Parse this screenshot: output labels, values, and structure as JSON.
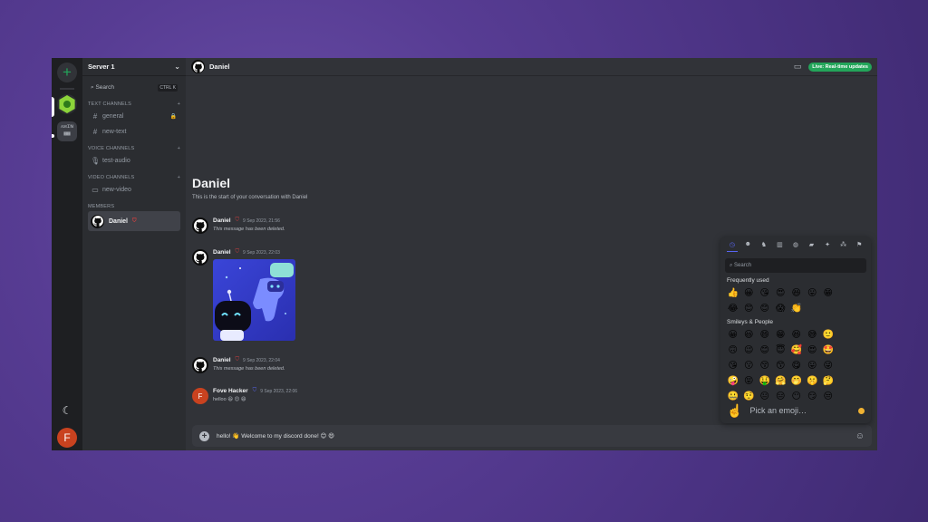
{
  "server_rail": {
    "add_label": "+",
    "server2_label": "ᴀᴍɪɴ ▦▦",
    "user_initial": "F",
    "moon": "☾"
  },
  "sidebar": {
    "server_name": "Server 1",
    "search_label": "Search",
    "search_kbd": "CTRL K",
    "categories": {
      "text": "TEXT CHANNELS",
      "voice": "VOICE CHANNELS",
      "video": "VIDEO CHANNELS",
      "members": "MEMBERS"
    },
    "channels": {
      "general": "general",
      "new_text": "new-text",
      "test_audio": "test-audio",
      "new_video": "new-video"
    },
    "member_name": "Daniel"
  },
  "topbar": {
    "name": "Daniel",
    "live_label": "Live: Real-time updates"
  },
  "conversation": {
    "title": "Daniel",
    "subtitle": "This is the start of your conversation with Daniel"
  },
  "messages": [
    {
      "author": "Daniel",
      "time": "9 Sep 2023, 21:56",
      "text": "This message has been deleted."
    },
    {
      "author": "Daniel",
      "time": "9 Sep 2023, 22:03",
      "text": ""
    },
    {
      "author": "Daniel",
      "time": "9 Sep 2023, 22:04",
      "text": "This message has been deleted."
    },
    {
      "author": "Fove Hacker",
      "initial": "F",
      "time": "9 Sep 2023, 22:06",
      "text": "helloo 😆 😊 😄"
    }
  ],
  "composer": {
    "value": "hello! 👋 Welcome to my discord done! 😊 😄"
  },
  "emoji_picker": {
    "search_placeholder": "Search",
    "frequently_used_title": "Frequently used",
    "frequently_used": [
      "👍",
      "😀",
      "😘",
      "😍",
      "😆",
      "😛",
      "😁",
      "😂",
      "😊",
      "😊",
      "😱",
      "👏"
    ],
    "smileys_title": "Smileys & People",
    "smileys": [
      "😀",
      "😃",
      "😄",
      "😁",
      "😆",
      "😅",
      "🙂",
      "🙃",
      "😉",
      "😊",
      "😇",
      "🥰",
      "😍",
      "🤩",
      "😘",
      "😗",
      "😚",
      "😙",
      "😋",
      "😛",
      "😜",
      "🤪",
      "😝",
      "🤑",
      "🤗",
      "🤭",
      "🤫",
      "🤔",
      "🤐",
      "🤨",
      "😐",
      "😑",
      "😶",
      "😏",
      "😒"
    ],
    "footer_hint": "Pick an emoji…",
    "footer_hand": "☝️"
  }
}
